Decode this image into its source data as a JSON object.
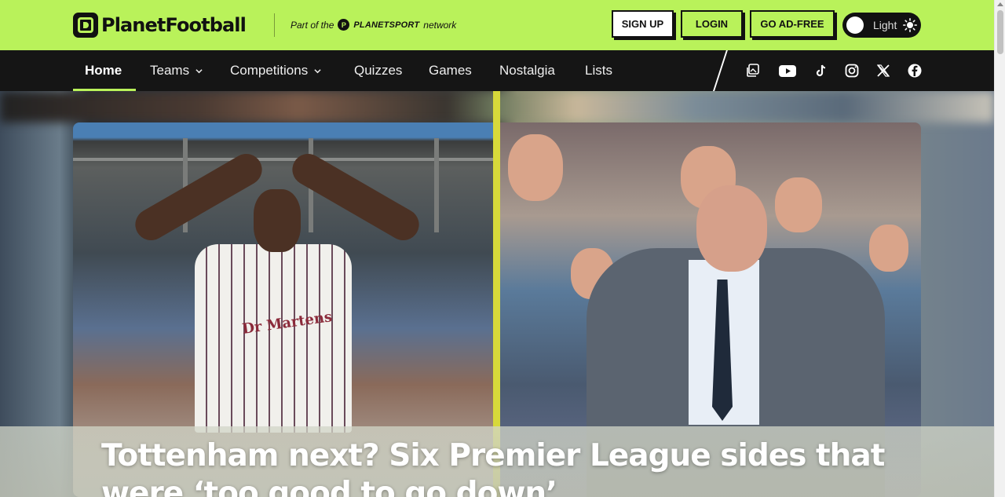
{
  "header": {
    "logo_text": "PlanetFootball",
    "network_prefix": "Part of the",
    "network_name": "PLANETSPORT",
    "network_suffix": "network",
    "buttons": {
      "signup": "SIGN UP",
      "login": "LOGIN",
      "adfree": "GO AD-FREE"
    },
    "theme_label": "Light"
  },
  "nav": {
    "items": [
      {
        "label": "Home",
        "active": true
      },
      {
        "label": "Teams",
        "dropdown": true
      },
      {
        "label": "Competitions",
        "dropdown": true
      },
      {
        "label": "Quizzes"
      },
      {
        "label": "Games"
      },
      {
        "label": "Nostalgia"
      },
      {
        "label": "Lists"
      }
    ],
    "social_icons": [
      "gallery-icon",
      "youtube-icon",
      "tiktok-icon",
      "instagram-icon",
      "x-icon",
      "facebook-icon"
    ]
  },
  "hero": {
    "headline": "Tottenham next? Six Premier League sides that were ‘too good to go down’",
    "shirt_sponsor": "Dr Martens"
  },
  "colors": {
    "brand_green": "#b9f25a",
    "nav_bg": "#151515",
    "accent_yellow": "#d7d93a"
  }
}
